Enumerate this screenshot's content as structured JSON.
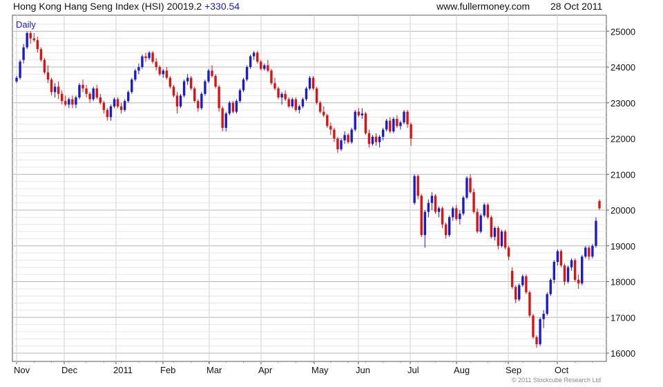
{
  "header": {
    "title": "Hong Kong Hang Seng Index (HSI) 20019.2",
    "change": "+330.54",
    "website": "www.fullermoney.com",
    "date": "28 Oct 2011"
  },
  "copyright": "© 2011 Stockcube Research Ltd",
  "colors": {
    "up": "#1a1ad0",
    "down": "#dd1111",
    "grid": "#c8c8c8",
    "axis": "#555555",
    "text": "#111111"
  },
  "chart_data": {
    "type": "candlestick",
    "interval_label": "Daily",
    "xlabels": [
      "Nov",
      "Dec",
      "2011",
      "Feb",
      "Mar",
      "Apr",
      "May",
      "Jun",
      "Jul",
      "Aug",
      "Sep",
      "Oct"
    ],
    "ylim": [
      15800,
      25300
    ],
    "yticks": [
      16000,
      17000,
      18000,
      19000,
      20000,
      21000,
      22000,
      23000,
      24000,
      25000
    ],
    "grid": true,
    "y_axis_side": "right",
    "series": [
      [
        1,
        23600,
        23750,
        23550,
        23700
      ],
      [
        2,
        23700,
        24200,
        23650,
        24150
      ],
      [
        3,
        24200,
        24650,
        24100,
        24550
      ],
      [
        4,
        24550,
        25000,
        24500,
        24950
      ],
      [
        5,
        24950,
        25000,
        24650,
        24800
      ],
      [
        6,
        24800,
        24950,
        24700,
        24750
      ],
      [
        7,
        24750,
        24850,
        24400,
        24500
      ],
      [
        8,
        24500,
        24550,
        24150,
        24200
      ],
      [
        9,
        24200,
        24250,
        23800,
        23850
      ],
      [
        10,
        23850,
        24050,
        23550,
        23650
      ],
      [
        11,
        23650,
        23700,
        23200,
        23300
      ],
      [
        12,
        23300,
        23550,
        23150,
        23450
      ],
      [
        13,
        23450,
        23600,
        23100,
        23250
      ],
      [
        14,
        23250,
        23350,
        22950,
        23050
      ],
      [
        15,
        23050,
        23200,
        22900,
        22950
      ],
      [
        16,
        22950,
        23150,
        22850,
        23100
      ],
      [
        17,
        23100,
        23200,
        22850,
        22950
      ],
      [
        18,
        22950,
        23200,
        22850,
        23150
      ],
      [
        19,
        23150,
        23550,
        23100,
        23500
      ],
      [
        20,
        23500,
        23650,
        23300,
        23400
      ],
      [
        21,
        23400,
        23500,
        23150,
        23250
      ],
      [
        22,
        23250,
        23300,
        23000,
        23100
      ],
      [
        23,
        23100,
        23450,
        23050,
        23400
      ],
      [
        24,
        23400,
        23500,
        23100,
        23150
      ],
      [
        25,
        23150,
        23250,
        22950,
        23000
      ],
      [
        26,
        23000,
        23050,
        22700,
        22800
      ],
      [
        27,
        22800,
        22850,
        22500,
        22600
      ],
      [
        28,
        22600,
        22950,
        22500,
        22900
      ],
      [
        29,
        22900,
        23150,
        22850,
        23100
      ],
      [
        30,
        23100,
        23150,
        22850,
        22900
      ],
      [
        31,
        22900,
        23000,
        22700,
        22800
      ],
      [
        32,
        22800,
        23100,
        22750,
        23050
      ],
      [
        33,
        23050,
        23350,
        23000,
        23300
      ],
      [
        34,
        23300,
        23700,
        23250,
        23650
      ],
      [
        35,
        23650,
        23950,
        23600,
        23900
      ],
      [
        36,
        23900,
        24100,
        23800,
        24000
      ],
      [
        37,
        24000,
        24350,
        23950,
        24300
      ],
      [
        38,
        24300,
        24400,
        24150,
        24250
      ],
      [
        39,
        24250,
        24450,
        24200,
        24400
      ],
      [
        40,
        24400,
        24450,
        24100,
        24150
      ],
      [
        41,
        24150,
        24250,
        23900,
        24000
      ],
      [
        42,
        24000,
        24050,
        23750,
        23800
      ],
      [
        43,
        23800,
        23950,
        23700,
        23900
      ],
      [
        44,
        23900,
        24000,
        23650,
        23700
      ],
      [
        45,
        23700,
        23750,
        23400,
        23450
      ],
      [
        46,
        23450,
        23500,
        23150,
        23200
      ],
      [
        47,
        23200,
        23300,
        22700,
        22900
      ],
      [
        48,
        22900,
        23250,
        22850,
        23200
      ],
      [
        49,
        23200,
        23650,
        23150,
        23600
      ],
      [
        50,
        23600,
        23800,
        23500,
        23700
      ],
      [
        51,
        23700,
        23750,
        23350,
        23400
      ],
      [
        52,
        23400,
        23450,
        23000,
        23050
      ],
      [
        53,
        23050,
        23100,
        22750,
        22850
      ],
      [
        54,
        22850,
        23300,
        22800,
        23250
      ],
      [
        55,
        23250,
        23650,
        23200,
        23600
      ],
      [
        56,
        23600,
        23950,
        23550,
        23900
      ],
      [
        57,
        23900,
        24050,
        23700,
        23750
      ],
      [
        58,
        23750,
        23800,
        23400,
        23450
      ],
      [
        59,
        23450,
        23500,
        22750,
        22850
      ],
      [
        60,
        22850,
        22900,
        22200,
        22300
      ],
      [
        61,
        22300,
        22750,
        22200,
        22700
      ],
      [
        62,
        22700,
        23050,
        22650,
        23000
      ],
      [
        63,
        23000,
        23050,
        22700,
        22750
      ],
      [
        64,
        22750,
        23100,
        22700,
        23050
      ],
      [
        65,
        23050,
        23400,
        23000,
        23350
      ],
      [
        66,
        23350,
        23700,
        23300,
        23650
      ],
      [
        67,
        23650,
        24050,
        23600,
        24000
      ],
      [
        68,
        24000,
        24350,
        23950,
        24300
      ],
      [
        69,
        24300,
        24450,
        24200,
        24400
      ],
      [
        70,
        24400,
        24450,
        24100,
        24150
      ],
      [
        71,
        24150,
        24200,
        23900,
        23950
      ],
      [
        72,
        23950,
        24100,
        23900,
        24050
      ],
      [
        73,
        24050,
        24200,
        23850,
        23900
      ],
      [
        74,
        23900,
        23950,
        23500,
        23550
      ],
      [
        75,
        23550,
        23700,
        23350,
        23400
      ],
      [
        76,
        23400,
        23450,
        23100,
        23150
      ],
      [
        77,
        23150,
        23300,
        22950,
        23250
      ],
      [
        78,
        23250,
        23350,
        23050,
        23100
      ],
      [
        79,
        23100,
        23150,
        22850,
        22900
      ],
      [
        80,
        22900,
        23150,
        22850,
        23100
      ],
      [
        81,
        23100,
        23150,
        22750,
        22800
      ],
      [
        82,
        22800,
        22950,
        22700,
        22900
      ],
      [
        83,
        22900,
        23150,
        22850,
        23100
      ],
      [
        84,
        23100,
        23450,
        23050,
        23400
      ],
      [
        85,
        23400,
        23750,
        23350,
        23700
      ],
      [
        86,
        23700,
        23750,
        23350,
        23400
      ],
      [
        87,
        23400,
        23450,
        22950,
        23000
      ],
      [
        88,
        23000,
        23050,
        22700,
        22750
      ],
      [
        89,
        22750,
        22900,
        22600,
        22650
      ],
      [
        90,
        22650,
        22700,
        22300,
        22350
      ],
      [
        91,
        22350,
        22450,
        22100,
        22250
      ],
      [
        92,
        22250,
        22300,
        21900,
        22000
      ],
      [
        93,
        22000,
        22050,
        21600,
        21700
      ],
      [
        94,
        21700,
        22000,
        21650,
        21950
      ],
      [
        95,
        21950,
        22200,
        21850,
        22100
      ],
      [
        96,
        22100,
        22150,
        21850,
        21900
      ],
      [
        97,
        21900,
        22300,
        21850,
        22250
      ],
      [
        98,
        22250,
        22800,
        22200,
        22750
      ],
      [
        99,
        22750,
        22850,
        22600,
        22650
      ],
      [
        100,
        22650,
        22850,
        22550,
        22700
      ],
      [
        101,
        22700,
        22750,
        22100,
        22150
      ],
      [
        102,
        22150,
        22250,
        21750,
        21850
      ],
      [
        103,
        21850,
        22100,
        21800,
        22050
      ],
      [
        104,
        22050,
        22150,
        21800,
        21900
      ],
      [
        105,
        21900,
        22100,
        21750,
        22050
      ],
      [
        106,
        22050,
        22300,
        21950,
        22250
      ],
      [
        107,
        22250,
        22550,
        22200,
        22500
      ],
      [
        108,
        22500,
        22600,
        22150,
        22200
      ],
      [
        109,
        22200,
        22600,
        22150,
        22550
      ],
      [
        110,
        22550,
        22650,
        22300,
        22350
      ],
      [
        111,
        22350,
        22500,
        22250,
        22450
      ],
      [
        112,
        22450,
        22800,
        22400,
        22750
      ],
      [
        113,
        22750,
        22800,
        22300,
        22400
      ],
      [
        114,
        22400,
        22450,
        21800,
        22000
      ],
      [
        115,
        20200,
        21000,
        20150,
        20950
      ],
      [
        116,
        20950,
        21000,
        20300,
        20400
      ],
      [
        117,
        20400,
        20450,
        19250,
        19300
      ],
      [
        118,
        19300,
        20000,
        18950,
        19950
      ],
      [
        119,
        19950,
        20300,
        19800,
        20200
      ],
      [
        120,
        20200,
        20500,
        20000,
        20400
      ],
      [
        121,
        20400,
        20450,
        19900,
        19950
      ],
      [
        122,
        19950,
        20100,
        19800,
        20050
      ],
      [
        123,
        20050,
        20100,
        19500,
        19600
      ],
      [
        124,
        19600,
        19650,
        19200,
        19300
      ],
      [
        125,
        19300,
        19850,
        19250,
        19800
      ],
      [
        126,
        19800,
        20100,
        19700,
        20050
      ],
      [
        127,
        20050,
        20150,
        19700,
        19750
      ],
      [
        128,
        19750,
        20000,
        19600,
        19900
      ],
      [
        129,
        19900,
        20400,
        19850,
        20350
      ],
      [
        130,
        20350,
        20950,
        20300,
        20900
      ],
      [
        131,
        20900,
        21000,
        20450,
        20500
      ],
      [
        132,
        20500,
        20600,
        19900,
        19950
      ],
      [
        133,
        19950,
        20050,
        19350,
        19400
      ],
      [
        134,
        19400,
        19900,
        19350,
        19850
      ],
      [
        135,
        19850,
        20200,
        19800,
        20150
      ],
      [
        136,
        20150,
        20200,
        19750,
        19800
      ],
      [
        137,
        19800,
        19850,
        19200,
        19250
      ],
      [
        138,
        19250,
        19550,
        19150,
        19500
      ],
      [
        139,
        19500,
        19550,
        18900,
        19000
      ],
      [
        140,
        19000,
        19450,
        18950,
        19400
      ],
      [
        141,
        19400,
        19450,
        18900,
        18950
      ],
      [
        142,
        18950,
        19000,
        18600,
        18700
      ],
      [
        143,
        18300,
        18400,
        17800,
        17850
      ],
      [
        144,
        17850,
        17900,
        17400,
        17500
      ],
      [
        145,
        17500,
        17950,
        17450,
        17900
      ],
      [
        146,
        17900,
        18200,
        17850,
        18150
      ],
      [
        147,
        18150,
        18200,
        17650,
        17700
      ],
      [
        148,
        17700,
        17750,
        17000,
        17050
      ],
      [
        149,
        17050,
        17100,
        16400,
        16450
      ],
      [
        150,
        16450,
        16500,
        16150,
        16250
      ],
      [
        151,
        16250,
        17000,
        16200,
        16950
      ],
      [
        152,
        16950,
        17200,
        16700,
        17100
      ],
      [
        153,
        17100,
        17700,
        17050,
        17650
      ],
      [
        154,
        17650,
        18100,
        17600,
        18050
      ],
      [
        155,
        18050,
        18600,
        17950,
        18550
      ],
      [
        156,
        18550,
        18900,
        18450,
        18850
      ],
      [
        157,
        18850,
        18900,
        18400,
        18450
      ],
      [
        158,
        18450,
        18500,
        17900,
        18000
      ],
      [
        159,
        18000,
        18450,
        17950,
        18400
      ],
      [
        160,
        18400,
        18650,
        18300,
        18600
      ],
      [
        161,
        18600,
        18650,
        18000,
        18050
      ],
      [
        162,
        18050,
        18200,
        17800,
        17950
      ],
      [
        163,
        17950,
        18750,
        17900,
        18700
      ],
      [
        164,
        18700,
        19000,
        18650,
        18950
      ],
      [
        165,
        18950,
        19000,
        18600,
        18700
      ],
      [
        166,
        18700,
        19050,
        18650,
        19000
      ],
      [
        167,
        19000,
        19800,
        18950,
        19700
      ],
      [
        168,
        20250,
        20300,
        20000,
        20050
      ]
    ]
  }
}
